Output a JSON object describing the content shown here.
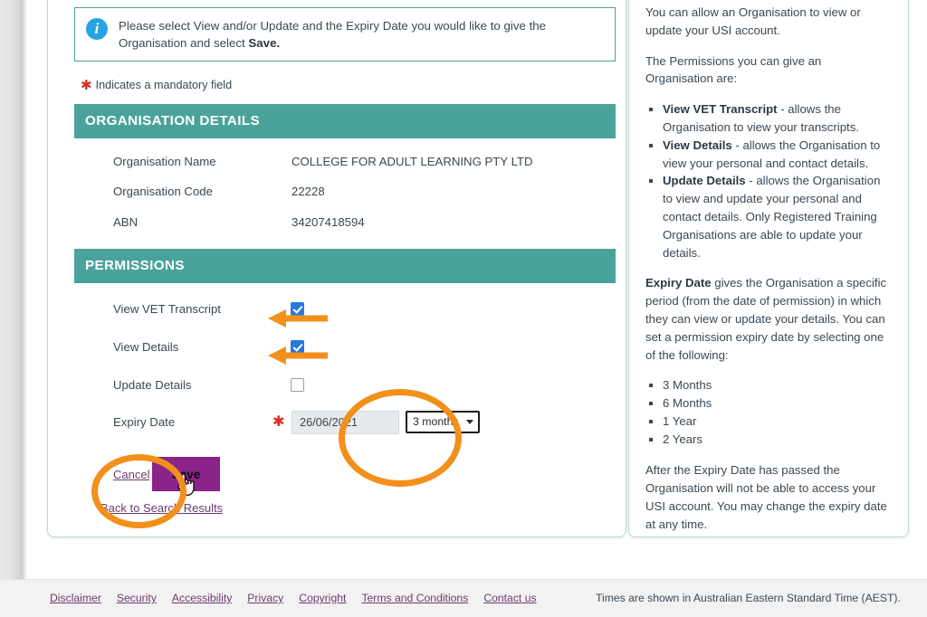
{
  "info_box": {
    "icon": "info-circle-icon",
    "text_before": "Please select View and/or Update and the Expiry Date you would like to give the Organisation and select ",
    "text_bold": "Save.",
    "full_text": "Please select View and/or Update and the Expiry Date you would like to give the Organisation and select Save."
  },
  "mandatory_note": "Indicates a mandatory field",
  "organisation_details": {
    "header": "ORGANISATION DETAILS",
    "rows": [
      {
        "label": "Organisation Name",
        "value": "COLLEGE FOR ADULT LEARNING PTY LTD"
      },
      {
        "label": "Organisation Code",
        "value": "22228"
      },
      {
        "label": "ABN",
        "value": "34207418594"
      }
    ]
  },
  "permissions": {
    "header": "PERMISSIONS",
    "checkboxes": [
      {
        "label": "View VET Transcript",
        "checked": true
      },
      {
        "label": "View Details",
        "checked": true
      },
      {
        "label": "Update Details",
        "checked": false
      }
    ],
    "expiry": {
      "label": "Expiry Date",
      "required_marker": "*",
      "date_value": "26/06/2021",
      "period_selected": "3 months",
      "period_options": [
        "3 months",
        "6 months",
        "1 year",
        "2 years"
      ]
    }
  },
  "actions": {
    "cancel_label": "Cancel",
    "save_label": "Save",
    "back_label": "Back to Search Results"
  },
  "help": {
    "p1": "You can allow an Organisation to view or update your USI account.",
    "p2": "The Permissions you can give an Organisation are:",
    "permission_items": [
      {
        "term": "View VET Transcript",
        "desc": " - allows the Organisation to view your transcripts."
      },
      {
        "term": "View Details",
        "desc": " - allows the Organisation to view your personal and contact details."
      },
      {
        "term": "Update Details",
        "desc": " - allows the Organisation to view and update your personal and contact details. Only Registered Training Organisations are able to update your details."
      }
    ],
    "expiry_term": "Expiry Date",
    "expiry_desc": " gives the Organisation a specific period (from the date of permission) in which they can view or update your details. You can set a permission expiry date by selecting one of the following:",
    "expiry_options": [
      "3 Months",
      "6 Months",
      "1 Year",
      "2 Years"
    ],
    "p3": "After the Expiry Date has passed the Organisation will not be able to access your USI account. You may change the expiry date at any time."
  },
  "footer": {
    "links": [
      "Disclaimer",
      "Security",
      "Accessibility",
      "Privacy",
      "Copyright",
      "Terms and Conditions",
      "Contact us"
    ],
    "note": "Times are shown in Australian Eastern Standard Time (AEST)."
  },
  "annotations": {
    "color": "#f2901b",
    "arrow_1_target": "View VET Transcript checkbox",
    "arrow_2_target": "View Details checkbox",
    "ellipse_1_target": "expiry period dropdown",
    "ellipse_2_target": "Save button"
  },
  "colors": {
    "section_header_teal": "#4aa39b",
    "save_purple": "#8a2489",
    "checkbox_blue": "#2777e0",
    "link_purple": "#6e3a6e",
    "required_red": "#e02b20",
    "annotation_orange": "#f2901b"
  }
}
